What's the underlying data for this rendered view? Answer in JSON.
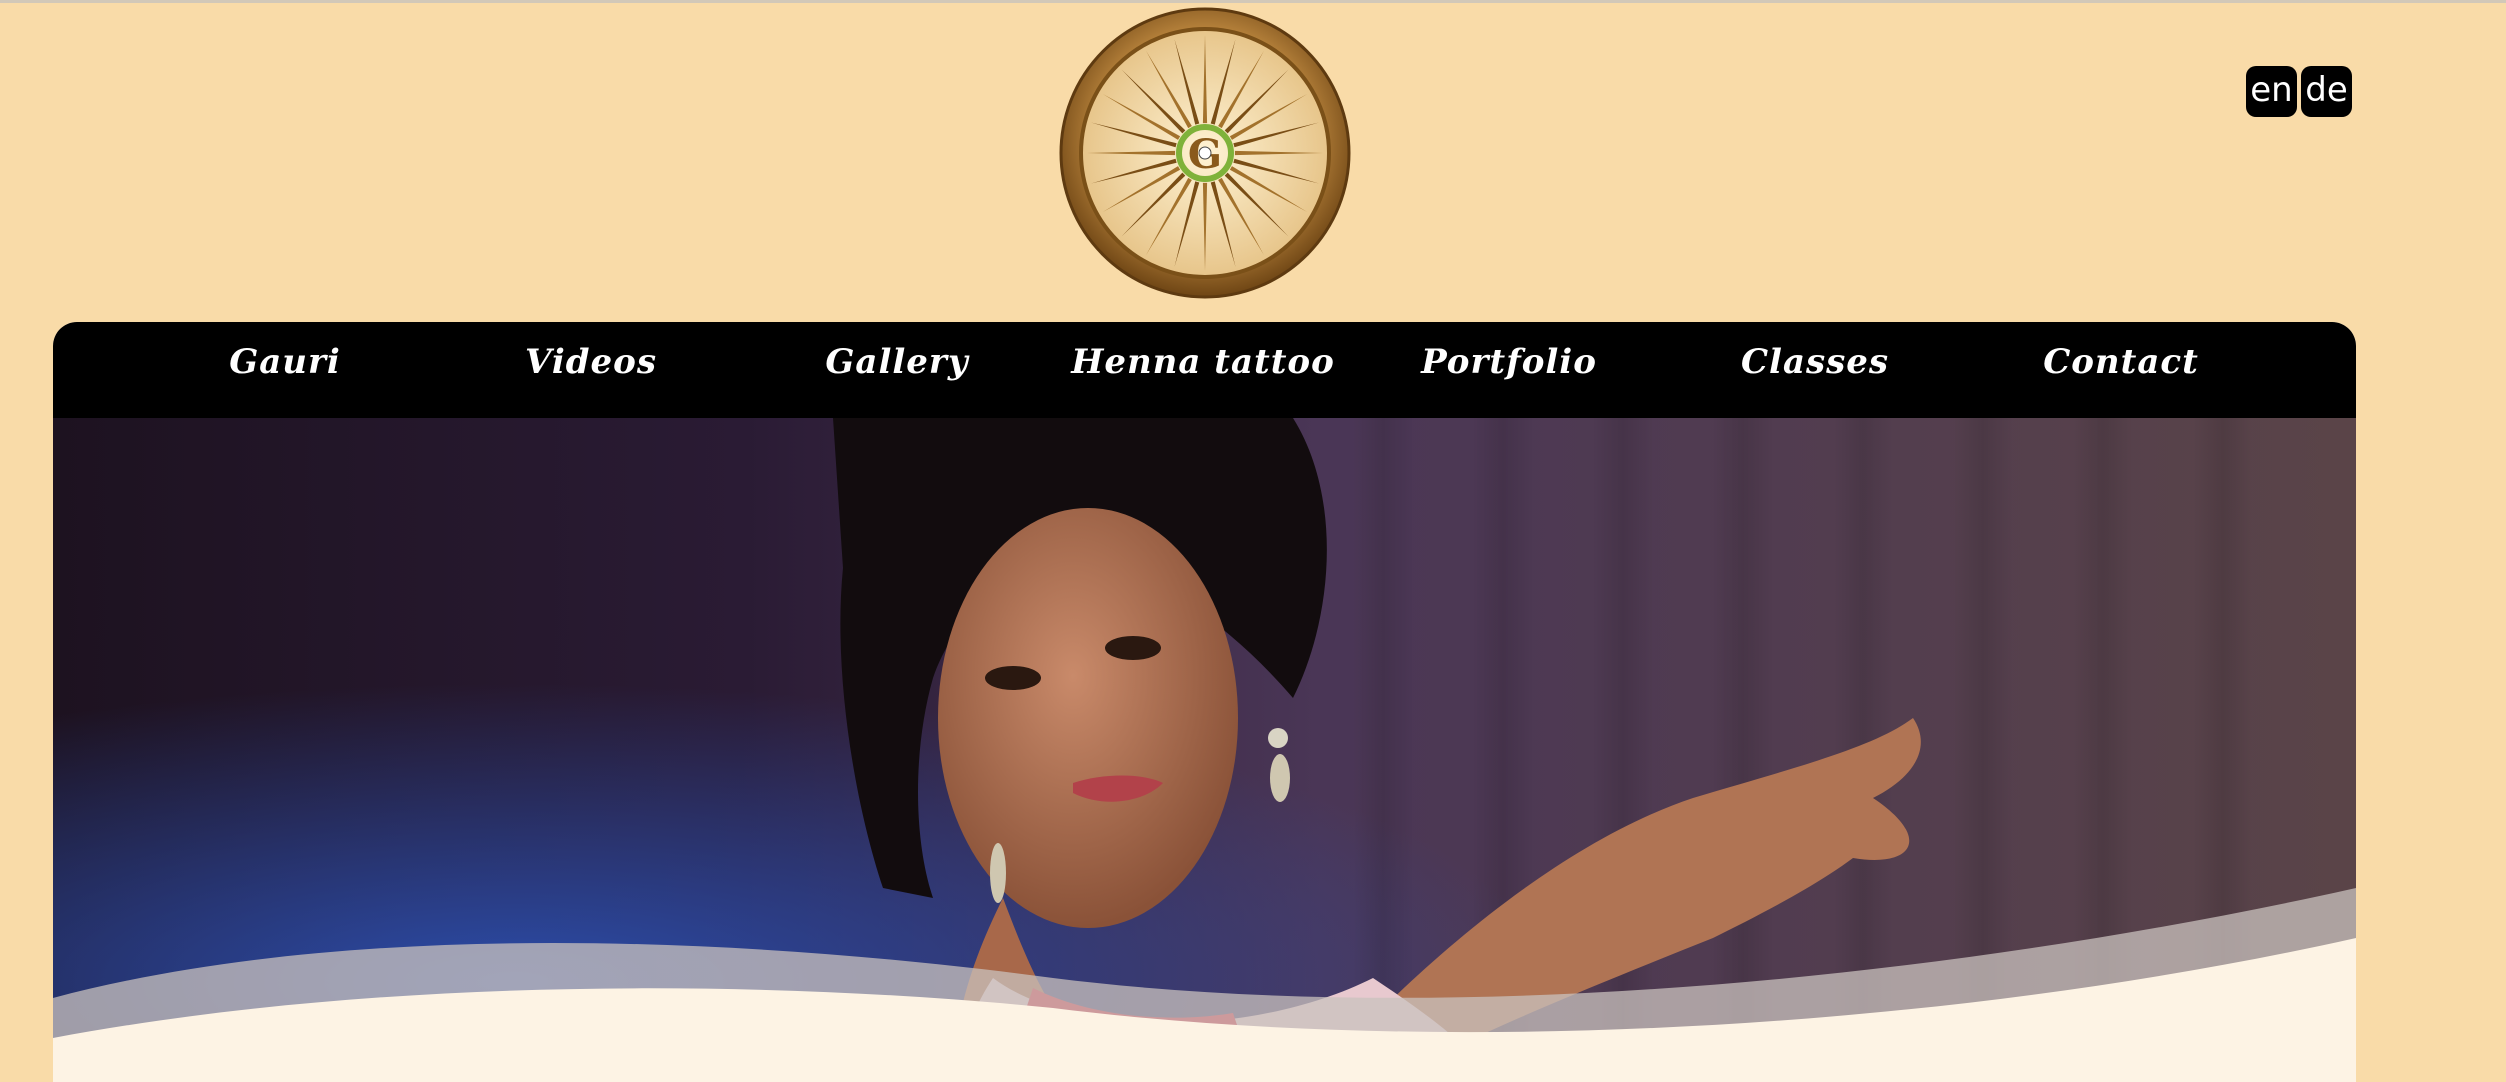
{
  "logo": {
    "icon": "wheel-logo-icon",
    "letter": "G"
  },
  "language": {
    "items": [
      {
        "label": "en"
      },
      {
        "label": "de"
      }
    ]
  },
  "nav": {
    "items": [
      {
        "label": "Gauri"
      },
      {
        "label": "Videos"
      },
      {
        "label": "Gallery"
      },
      {
        "label": "Henna tattoo"
      },
      {
        "label": "Portfolio"
      },
      {
        "label": "Classes"
      },
      {
        "label": "Contact"
      }
    ]
  },
  "hero": {
    "image": "dancer-photo"
  },
  "colors": {
    "page_bg": "#f9dba8",
    "nav_bg": "#000000",
    "content_bg": "#fdf3e4",
    "wheel_gold": "#9a6a26"
  }
}
